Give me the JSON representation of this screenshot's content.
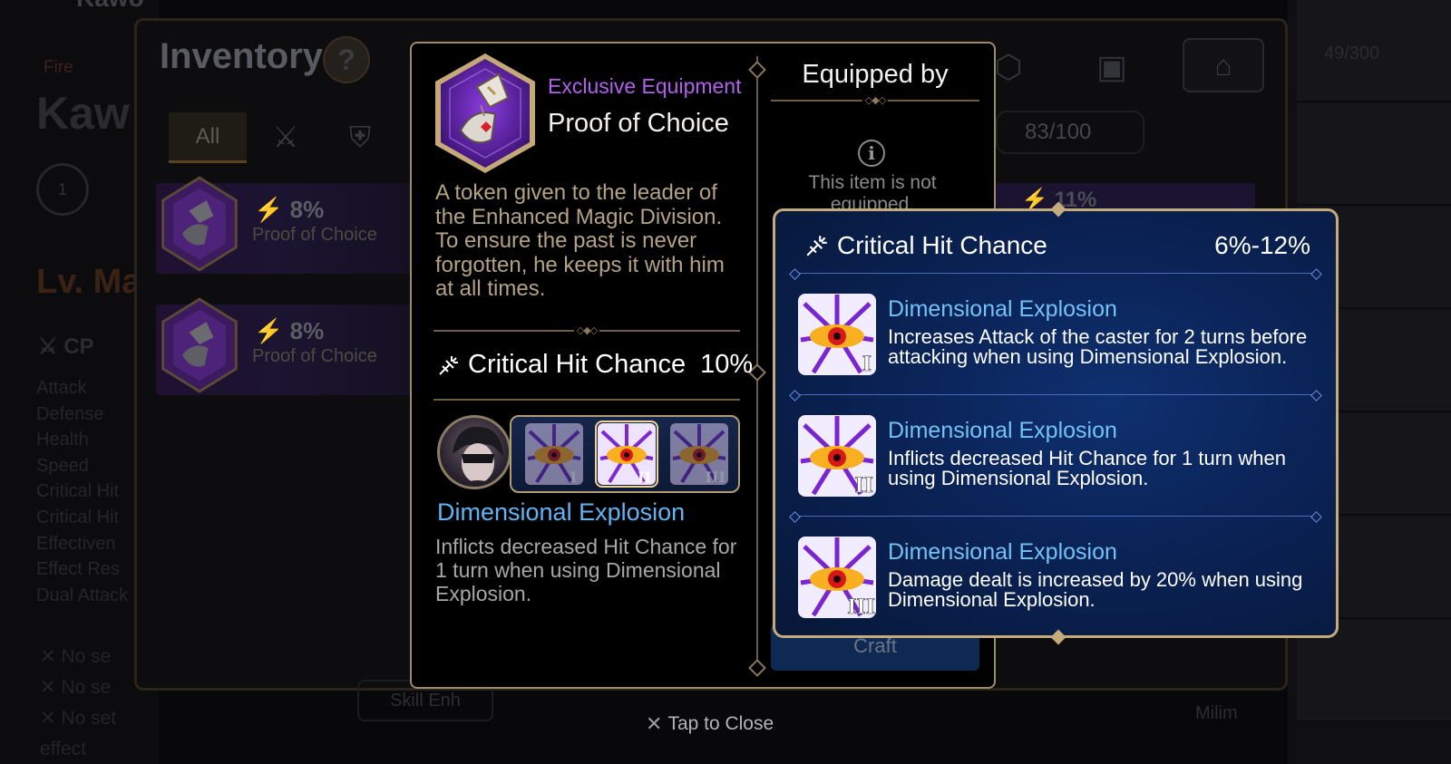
{
  "background": {
    "inventory_title": "Inventory",
    "help_label": "?",
    "tab_all": "All",
    "capacity": "83/100",
    "item_count": "49/300",
    "character_element": "Fire",
    "lv_text": "Lv. Ma",
    "cp_label": "CP",
    "stat_labels": [
      "Attack",
      "Defense",
      "Health",
      "Speed",
      "Critical Hit",
      "Critical Hit",
      "Effectiven",
      "Effect Res",
      "Dual Attack"
    ],
    "set_effects": [
      "No se",
      "No se",
      "No set effect"
    ],
    "list_items": [
      {
        "stat": "8%",
        "name": "Proof of Choice"
      },
      {
        "stat": "8%",
        "name": "Proof of Choice"
      }
    ],
    "right_partial_stat": "11%",
    "milim_label": "Milim"
  },
  "detail": {
    "equipment_type": "Exclusive Equipment",
    "equipment_name": "Proof of Choice",
    "description": "A token given to the leader of the Enhanced Magic Division. To ensure the past is never forgotten, he keeps it with him at all times.",
    "stat_name": "Critical Hit Chance",
    "stat_value": "10%",
    "skill_name": "Dimensional Explosion",
    "skill_desc": "Inflicts decreased Hit Chance for 1 turn when using Dimensional Explosion.",
    "skill_levels": [
      "I",
      "II",
      "III"
    ],
    "selected_level": "II",
    "equipped_by_title": "Equipped by",
    "info_icon": "i",
    "not_equipped_text": "This item is not equipped.",
    "craft_label": "Craft"
  },
  "tooltip": {
    "stat_name": "Critical Hit Chance",
    "stat_range": "6%-12%",
    "entries": [
      {
        "level": "I",
        "title": "Dimensional Explosion",
        "desc": "Increases Attack of the caster for 2 turns before attacking when using Dimensional Explosion."
      },
      {
        "level": "II",
        "title": "Dimensional Explosion",
        "desc": "Inflicts decreased Hit Chance for 1 turn when using Dimensional Explosion."
      },
      {
        "level": "III",
        "title": "Dimensional Explosion",
        "desc": "Damage dealt is increased by 20% when using Dimensional Explosion."
      }
    ]
  },
  "close_hint": "Tap to Close",
  "colors": {
    "exclusive_purple": "#b062ea",
    "skill_blue": "#62b4f4",
    "gold_border": "#c4ab7c",
    "desc_tan": "#b3a384"
  },
  "icons": {
    "stat": "crit-hit-icon",
    "info": "info-icon",
    "close": "close-icon"
  }
}
